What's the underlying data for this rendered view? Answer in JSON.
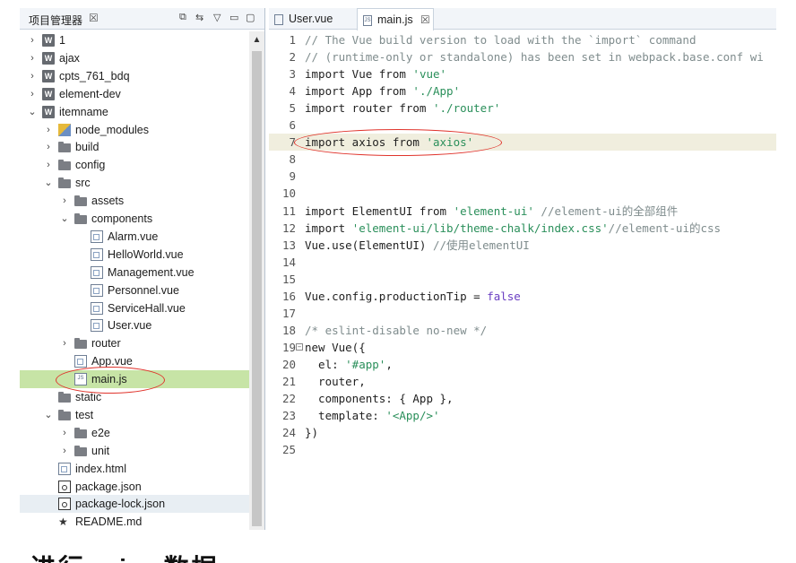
{
  "explorer": {
    "title": "项目管理器",
    "close": "☒",
    "toolbar": [
      "⧉",
      "⇆",
      "▽",
      "▭",
      "▢"
    ],
    "scroll_up": "▲",
    "rows": [
      {
        "arrow": "›",
        "icon": "w",
        "label": "1",
        "indent": 0
      },
      {
        "arrow": "›",
        "icon": "w",
        "label": "ajax",
        "indent": 0
      },
      {
        "arrow": "›",
        "icon": "w",
        "label": "cpts_761_bdq",
        "indent": 0
      },
      {
        "arrow": "›",
        "icon": "w",
        "label": "element-dev",
        "indent": 0
      },
      {
        "arrow": "⌄",
        "icon": "w",
        "label": "itemname",
        "indent": 0
      },
      {
        "arrow": "›",
        "icon": "nm",
        "label": "node_modules",
        "indent": 1
      },
      {
        "arrow": "›",
        "icon": "folder",
        "label": "build",
        "indent": 1
      },
      {
        "arrow": "›",
        "icon": "folder",
        "label": "config",
        "indent": 1
      },
      {
        "arrow": "⌄",
        "icon": "folder",
        "label": "src",
        "indent": 1
      },
      {
        "arrow": "›",
        "icon": "folder",
        "label": "assets",
        "indent": 2
      },
      {
        "arrow": "⌄",
        "icon": "folder",
        "label": "components",
        "indent": 2
      },
      {
        "arrow": "",
        "icon": "file",
        "label": "Alarm.vue",
        "indent": 3
      },
      {
        "arrow": "",
        "icon": "file",
        "label": "HelloWorld.vue",
        "indent": 3
      },
      {
        "arrow": "",
        "icon": "file",
        "label": "Management.vue",
        "indent": 3
      },
      {
        "arrow": "",
        "icon": "file",
        "label": "Personnel.vue",
        "indent": 3
      },
      {
        "arrow": "",
        "icon": "file",
        "label": "ServiceHall.vue",
        "indent": 3
      },
      {
        "arrow": "",
        "icon": "file",
        "label": "User.vue",
        "indent": 3
      },
      {
        "arrow": "›",
        "icon": "folder",
        "label": "router",
        "indent": 2
      },
      {
        "arrow": "",
        "icon": "file",
        "label": "App.vue",
        "indent": 2
      },
      {
        "arrow": "",
        "icon": "js",
        "label": "main.js",
        "indent": 2,
        "selected": true
      },
      {
        "arrow": "",
        "icon": "folder",
        "label": "static",
        "indent": 1
      },
      {
        "arrow": "⌄",
        "icon": "folder",
        "label": "test",
        "indent": 1
      },
      {
        "arrow": "›",
        "icon": "folder",
        "label": "e2e",
        "indent": 2
      },
      {
        "arrow": "›",
        "icon": "folder",
        "label": "unit",
        "indent": 2
      },
      {
        "arrow": "",
        "icon": "file",
        "label": "index.html",
        "indent": 1
      },
      {
        "arrow": "",
        "icon": "json",
        "label": "package.json",
        "indent": 1
      },
      {
        "arrow": "",
        "icon": "json",
        "label": "package-lock.json",
        "indent": 1,
        "hover": true
      },
      {
        "arrow": "",
        "icon": "star",
        "label": "README.md",
        "indent": 1
      }
    ]
  },
  "editor": {
    "tabs": [
      {
        "label": "User.vue",
        "icon": "vue",
        "active": false,
        "close": ""
      },
      {
        "label": "main.js",
        "icon": "JS",
        "active": true,
        "close": "☒"
      }
    ],
    "lines": [
      {
        "n": "1",
        "parts": [
          [
            "comment",
            "// The Vue build version to load with the `import` command"
          ]
        ]
      },
      {
        "n": "2",
        "parts": [
          [
            "comment",
            "// (runtime-only or standalone) has been set in webpack.base.conf wi"
          ]
        ]
      },
      {
        "n": "3",
        "parts": [
          [
            "kw",
            "import Vue from "
          ],
          [
            "str",
            "'vue'"
          ]
        ]
      },
      {
        "n": "4",
        "parts": [
          [
            "kw",
            "import App from "
          ],
          [
            "str",
            "'./App'"
          ]
        ]
      },
      {
        "n": "5",
        "parts": [
          [
            "kw",
            "import router from "
          ],
          [
            "str",
            "'./router'"
          ]
        ]
      },
      {
        "n": "6",
        "parts": []
      },
      {
        "n": "7",
        "parts": [
          [
            "kw",
            "import axios from "
          ],
          [
            "str",
            "'axios'"
          ]
        ],
        "highlight": true
      },
      {
        "n": "8",
        "parts": []
      },
      {
        "n": "9",
        "parts": []
      },
      {
        "n": "10",
        "parts": []
      },
      {
        "n": "11",
        "parts": [
          [
            "kw",
            "import ElementUI from "
          ],
          [
            "str",
            "'element-ui'"
          ],
          [
            "comment",
            " //element-ui的全部组件"
          ]
        ]
      },
      {
        "n": "12",
        "parts": [
          [
            "kw",
            "import "
          ],
          [
            "str",
            "'element-ui/lib/theme-chalk/index.css'"
          ],
          [
            "comment",
            "//element-ui的css"
          ]
        ]
      },
      {
        "n": "13",
        "parts": [
          [
            "kw",
            "Vue.use(ElementUI) "
          ],
          [
            "comment",
            "//使用elementUI"
          ]
        ]
      },
      {
        "n": "14",
        "parts": []
      },
      {
        "n": "15",
        "parts": []
      },
      {
        "n": "16",
        "parts": [
          [
            "kw",
            "Vue.config.productionTip = "
          ],
          [
            "bool",
            "false"
          ]
        ]
      },
      {
        "n": "17",
        "parts": []
      },
      {
        "n": "18",
        "parts": [
          [
            "comment",
            "/* eslint-disable no-new */"
          ]
        ]
      },
      {
        "n": "19",
        "parts": [
          [
            "kw",
            "new Vue({"
          ]
        ],
        "fold": "⊟"
      },
      {
        "n": "20",
        "parts": [
          [
            "kw",
            "  el: "
          ],
          [
            "str",
            "'#app'"
          ],
          [
            "kw",
            ","
          ]
        ]
      },
      {
        "n": "21",
        "parts": [
          [
            "kw",
            "  router,"
          ]
        ]
      },
      {
        "n": "22",
        "parts": [
          [
            "kw",
            "  components: { App },"
          ]
        ]
      },
      {
        "n": "23",
        "parts": [
          [
            "kw",
            "  template: "
          ],
          [
            "str",
            "'<App/>'"
          ]
        ]
      },
      {
        "n": "24",
        "parts": [
          [
            "kw",
            "})"
          ]
        ]
      },
      {
        "n": "25",
        "parts": []
      }
    ]
  },
  "below": {
    "title": "进行axios数据"
  },
  "colors": {
    "selected_row": "#c7e4a6",
    "highlight_line": "#f0eede",
    "annotation": "#e0342c"
  }
}
